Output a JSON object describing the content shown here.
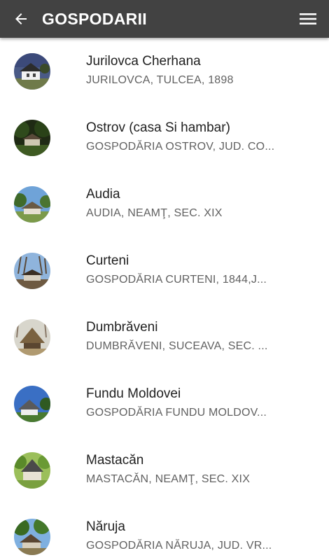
{
  "appbar": {
    "title": "GOSPODARII",
    "back_icon": "arrow-left-icon",
    "menu_icon": "hamburger-menu-icon"
  },
  "colors": {
    "appbar": "#424242",
    "title_text": "#212121",
    "subtitle_text": "#616161"
  },
  "items": [
    {
      "title": "Jurilovca Cherhana",
      "subtitle": "JURILOVCA, TULCEA, 1898"
    },
    {
      "title": "Ostrov (casa Si hambar)",
      "subtitle": "GOSPODĂRIA OSTROV, JUD. CO..."
    },
    {
      "title": "Audia",
      "subtitle": "AUDIA, NEAMŢ, SEC. XIX"
    },
    {
      "title": "Curteni",
      "subtitle": "GOSPODĂRIA CURTENI, 1844,J..."
    },
    {
      "title": "Dumbrăveni",
      "subtitle": "DUMBRĂVENI, SUCEAVA, SEC. ..."
    },
    {
      "title": "Fundu Moldovei",
      "subtitle": "GOSPODĂRIA FUNDU MOLDOV..."
    },
    {
      "title": "Mastacăn",
      "subtitle": "MASTACĂN, NEAMŢ, SEC. XIX"
    },
    {
      "title": "Năruja",
      "subtitle": "GOSPODĂRIA NĂRUJA, JUD. VR..."
    }
  ]
}
